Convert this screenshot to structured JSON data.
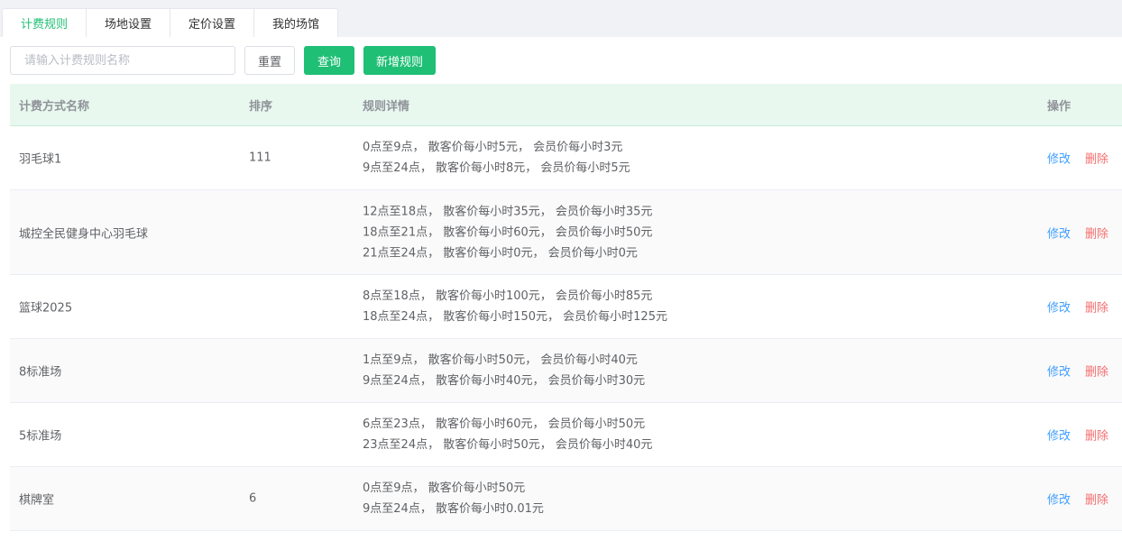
{
  "tabs": [
    {
      "label": "计费规则",
      "active": true
    },
    {
      "label": "场地设置",
      "active": false
    },
    {
      "label": "定价设置",
      "active": false
    },
    {
      "label": "我的场馆",
      "active": false
    }
  ],
  "toolbar": {
    "search_placeholder": "请输入计费规则名称",
    "search_value": "",
    "reset_label": "重置",
    "query_label": "查询",
    "add_label": "新增规则"
  },
  "table": {
    "headers": {
      "name": "计费方式名称",
      "order": "排序",
      "detail": "规则详情",
      "action": "操作"
    },
    "edit_label": "修改",
    "delete_label": "删除",
    "rows": [
      {
        "name": "羽毛球1",
        "order": "111",
        "details": [
          "0点至9点， 散客价每小时5元， 会员价每小时3元",
          "9点至24点， 散客价每小时8元， 会员价每小时5元"
        ]
      },
      {
        "name": "城控全民健身中心羽毛球",
        "order": "",
        "details": [
          "12点至18点， 散客价每小时35元， 会员价每小时35元",
          "18点至21点， 散客价每小时60元， 会员价每小时50元",
          "21点至24点， 散客价每小时0元， 会员价每小时0元"
        ]
      },
      {
        "name": "篮球2025",
        "order": "",
        "details": [
          "8点至18点， 散客价每小时100元， 会员价每小时85元",
          "18点至24点， 散客价每小时150元， 会员价每小时125元"
        ]
      },
      {
        "name": "8标准场",
        "order": "",
        "details": [
          "1点至9点， 散客价每小时50元， 会员价每小时40元",
          "9点至24点， 散客价每小时40元， 会员价每小时30元"
        ]
      },
      {
        "name": "5标准场",
        "order": "",
        "details": [
          "6点至23点， 散客价每小时60元， 会员价每小时50元",
          "23点至24点， 散客价每小时50元， 会员价每小时40元"
        ]
      },
      {
        "name": "棋牌室",
        "order": "6",
        "details": [
          "0点至9点， 散客价每小时50元",
          "9点至24点， 散客价每小时0.01元"
        ]
      }
    ]
  },
  "colors": {
    "accent": "#1fbf75",
    "edit": "#409eff",
    "delete": "#f56c6c",
    "header_bg": "#e8f8ef"
  }
}
